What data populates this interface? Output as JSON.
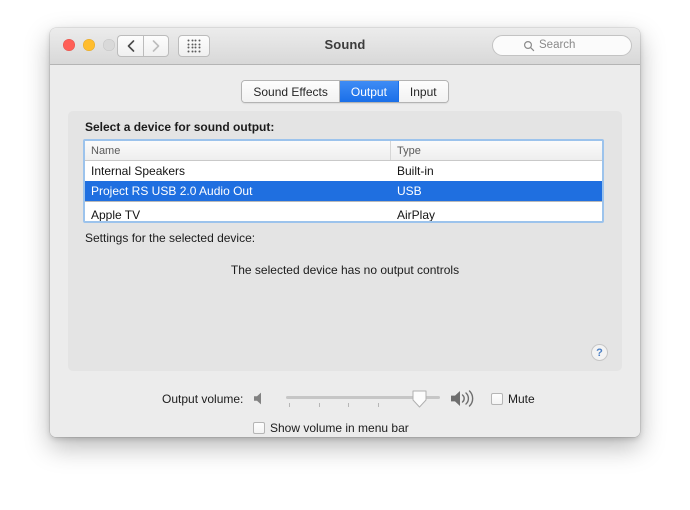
{
  "window": {
    "title": "Sound",
    "traffic_lights": [
      "close-button",
      "minimize-button",
      "zoom-button"
    ],
    "nav": {
      "back_icon": "chevron-left-icon",
      "forward_icon": "chevron-right-icon",
      "grid_icon": "grid-all-preferences-icon"
    },
    "search": {
      "placeholder": "Search",
      "icon": "search-icon",
      "value": ""
    }
  },
  "tabs": [
    {
      "label": "Sound Effects",
      "active": false
    },
    {
      "label": "Output",
      "active": true
    },
    {
      "label": "Input",
      "active": false
    }
  ],
  "panel": {
    "list_label": "Select a device for sound output:",
    "table": {
      "columns": [
        "Name",
        "Type"
      ],
      "rows": [
        {
          "name": "Internal Speakers",
          "type": "Built-in",
          "selected": false
        },
        {
          "name": "Project RS USB 2.0 Audio Out",
          "type": "USB",
          "selected": true
        },
        {
          "name": "Apple TV",
          "type": "AirPlay",
          "selected": false
        }
      ]
    },
    "settings_label": "Settings for the selected device:",
    "no_controls_message": "The selected device has no output controls",
    "help_label": "?"
  },
  "volume": {
    "label": "Output volume:",
    "low_icon": "speaker-low-icon",
    "high_icon": "speaker-high-icon",
    "slider_percent": 86,
    "mute_label": "Mute",
    "mute_checked": false,
    "show_in_menu_bar_label": "Show volume in menu bar",
    "show_in_menu_bar_checked": false
  },
  "colors": {
    "accent_blue": "#1f6fe0",
    "tab_active_blue": "#2f7bee",
    "focus_ring": "#9cc3ec",
    "window_bg": "#ececec",
    "panel_bg": "#e4e4e4",
    "table_bg": "#ffffff",
    "close_red": "#ff5f57",
    "minimize_yellow": "#ffbd2e",
    "zoom_gray": "#d9d9d9",
    "help_blue": "#4b7fc4"
  }
}
